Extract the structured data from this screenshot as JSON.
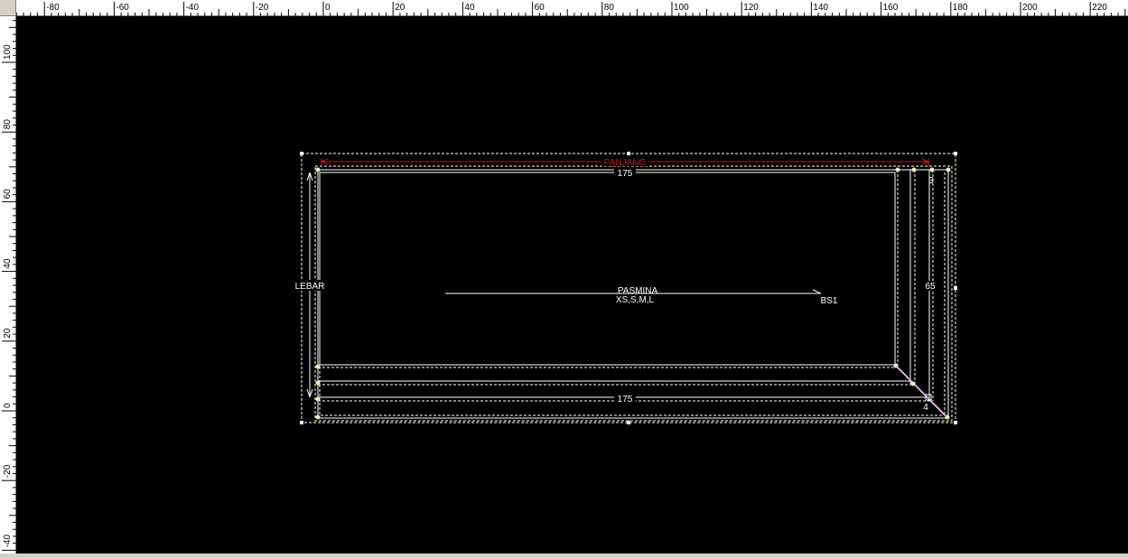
{
  "rulers": {
    "horizontal_labels": [
      "-80",
      "-60",
      "-40",
      "-20",
      "0",
      "20",
      "40",
      "60",
      "80",
      "100",
      "120",
      "140",
      "160",
      "180",
      "200",
      "220"
    ],
    "vertical_labels": [
      "100",
      "80",
      "60",
      "40",
      "20",
      "0",
      "-20",
      "-40"
    ]
  },
  "pattern": {
    "name": "PASMINA",
    "sizes": "XS,S,M,L",
    "piece_code": "BS1",
    "length_label": "PANJANG",
    "width_label": "LEBAR",
    "top_dimension": "175",
    "bottom_dimension": "175",
    "right_dimension": "65",
    "seam_top_right": "3",
    "seam_bottom_right": "4"
  },
  "colors": {
    "canvas": "#000000",
    "outline": "#ffffff",
    "dimension_line": "#d21414",
    "seam_corner": "#c040c0",
    "point": "#e8f0b8"
  }
}
